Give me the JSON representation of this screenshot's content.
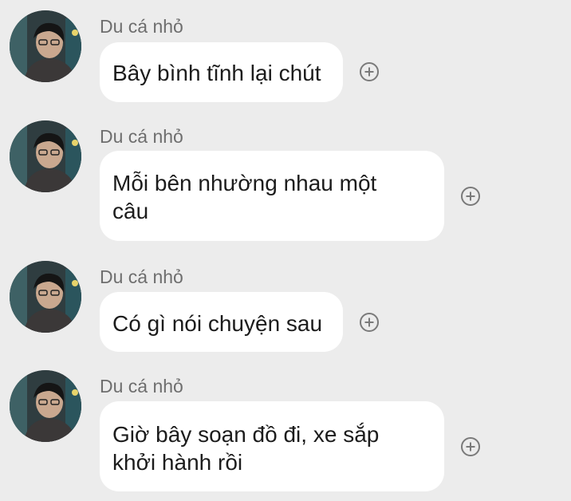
{
  "messages": [
    {
      "sender": "Du cá nhỏ",
      "lines": [
        "Bây bình tĩnh lại chút"
      ],
      "avatar_icon": "user-avatar",
      "action_icon": "add-circle-icon"
    },
    {
      "sender": "Du cá nhỏ",
      "lines": [
        "Mỗi bên nhường nhau một",
        "câu"
      ],
      "avatar_icon": "user-avatar",
      "action_icon": "add-circle-icon"
    },
    {
      "sender": "Du cá nhỏ",
      "lines": [
        "Có gì nói chuyện sau"
      ],
      "avatar_icon": "user-avatar",
      "action_icon": "add-circle-icon"
    },
    {
      "sender": "Du cá nhỏ",
      "lines": [
        "Giờ bây soạn đồ đi, xe sắp",
        "khởi hành rồi"
      ],
      "avatar_icon": "user-avatar",
      "action_icon": "add-circle-icon"
    }
  ],
  "colors": {
    "background": "#ececec",
    "bubble": "#ffffff",
    "sender_text": "#6e6e6e",
    "message_text": "#1c1c1c",
    "plus_icon": "#7a7a7a"
  }
}
